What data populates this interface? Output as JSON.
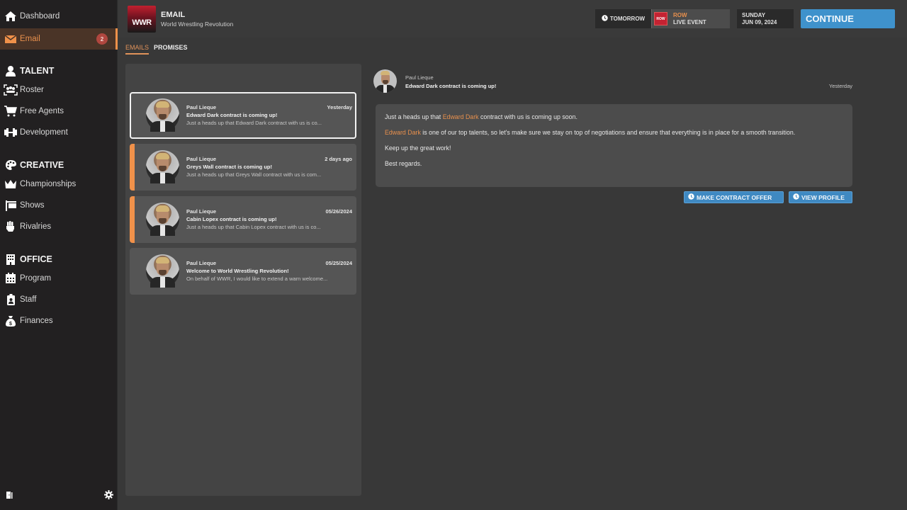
{
  "sidebar": {
    "items": [
      {
        "label": "Dashboard",
        "icon": "home-icon"
      },
      {
        "label": "Email",
        "icon": "envelope-icon",
        "badge": "2",
        "active": true
      }
    ],
    "sections": [
      {
        "title": "TALENT",
        "icon": "person-icon",
        "items": [
          {
            "label": "Roster",
            "icon": "group-icon"
          },
          {
            "label": "Free Agents",
            "icon": "cart-icon"
          },
          {
            "label": "Development",
            "icon": "dumbbell-icon"
          }
        ]
      },
      {
        "title": "CREATIVE",
        "icon": "palette-icon",
        "items": [
          {
            "label": "Championships",
            "icon": "crown-icon"
          },
          {
            "label": "Shows",
            "icon": "sign-icon"
          },
          {
            "label": "Rivalries",
            "icon": "fist-icon"
          }
        ]
      },
      {
        "title": "OFFICE",
        "icon": "building-icon",
        "items": [
          {
            "label": "Program",
            "icon": "calendar-icon"
          },
          {
            "label": "Staff",
            "icon": "id-badge-icon"
          },
          {
            "label": "Finances",
            "icon": "money-bag-icon"
          }
        ]
      }
    ],
    "bottom": {
      "left_icon": "exit-door-icon",
      "right_icon": "gear-icon"
    }
  },
  "header": {
    "logo_text": "WWR",
    "title": "EMAIL",
    "subtitle": "World Wrestling Revolution",
    "tomorrow_label": "TOMORROW",
    "event_logo_text": "ROW",
    "event_top": "ROW",
    "event_bottom": "LIVE EVENT",
    "date_day": "SUNDAY",
    "date_full": "JUN 09, 2024",
    "continue_label": "CONTINUE"
  },
  "tabs": [
    {
      "label": "EMAILS",
      "active": true
    },
    {
      "label": "PROMISES",
      "active": false
    }
  ],
  "emails": [
    {
      "from": "Paul Lieque",
      "date": "Yesterday",
      "subject": "Edward Dark contract is coming up!",
      "preview": "Just a heads up that Edward Dark contract with us is co...",
      "selected": true,
      "unread": false
    },
    {
      "from": "Paul Lieque",
      "date": "2 days ago",
      "subject": "Greys Wall contract is coming up!",
      "preview": "Just a heads up that Greys Wall contract with us is com...",
      "selected": false,
      "unread": true
    },
    {
      "from": "Paul Lieque",
      "date": "05/26/2024",
      "subject": "Cabin Lopex contract is coming up!",
      "preview": "Just a heads up that Cabin Lopex contract with us is co...",
      "selected": false,
      "unread": true
    },
    {
      "from": "Paul Lieque",
      "date": "05/25/2024",
      "subject": "Welcome to World Wrestling Revolution!",
      "preview": "On behalf of WWR, I would like to extend a warn welcome...",
      "selected": false,
      "unread": false
    }
  ],
  "detail": {
    "from": "Paul Lieque",
    "subject": "Edward Dark contract is coming up!",
    "date": "Yesterday",
    "p1_pre": "Just a heads up that ",
    "p1_name": "Edward Dark",
    "p1_post": " contract with us is coming up soon.",
    "p2_name": "Edward Dark",
    "p2_post": " is one of our top talents, so let's make sure we stay on top of negotiations and ensure that everything is in place for a smooth transition.",
    "p3": "Keep up the great work!",
    "p4": "Best regards.",
    "actions": {
      "offer_label": "MAKE CONTRACT OFFER",
      "profile_label": "VIEW PROFILE"
    }
  },
  "colors": {
    "accent": "#f0914a",
    "button_blue": "#3f92cc",
    "badge_red": "#b0473f"
  }
}
